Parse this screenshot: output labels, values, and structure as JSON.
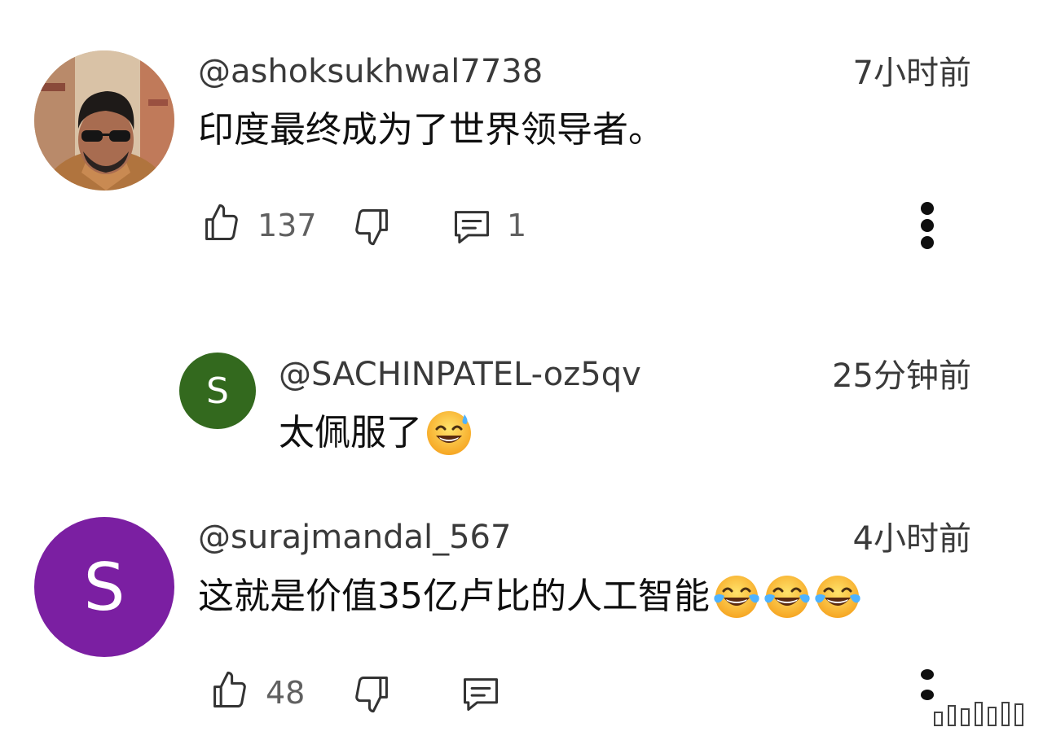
{
  "comments": [
    {
      "username": "@ashoksukhwal7738",
      "timestamp": "7小时前",
      "text": "印度最终成为了世界领导者。",
      "likes": "137",
      "replies": "1",
      "avatar_type": "photo"
    },
    {
      "username": "@SACHINPATEL-oz5qv",
      "timestamp": "25分钟前",
      "text": "太佩服了",
      "emoji": [
        "sweat-smile"
      ],
      "avatar_letter": "S",
      "avatar_color": "#33691e",
      "is_reply": true
    },
    {
      "username": "@surajmandal_567",
      "timestamp": "4小时前",
      "text": "这就是价值35亿卢比的人工智能",
      "emoji": [
        "tears-of-joy",
        "tears-of-joy",
        "tears-of-joy"
      ],
      "likes": "48",
      "avatar_letter": "S",
      "avatar_color": "#7b1fa2"
    }
  ],
  "icons": {
    "like": "thumbs-up-icon",
    "dislike": "thumbs-down-icon",
    "reply": "comment-icon",
    "more": "more-vertical-icon"
  }
}
